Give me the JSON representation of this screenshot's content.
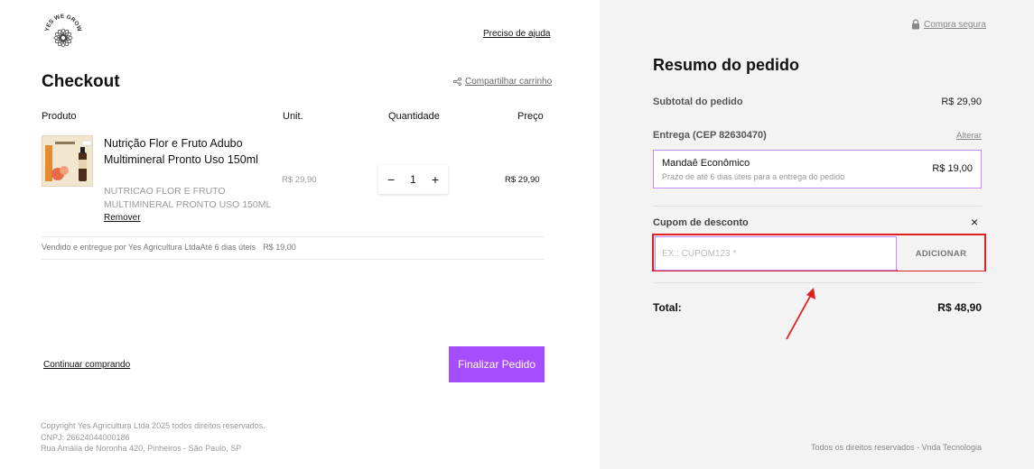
{
  "brand": {
    "logo_text": "YES WE GROW"
  },
  "header": {
    "help_link": "Preciso de ajuda",
    "title": "Checkout",
    "share_label": "Compartilhar carrinho"
  },
  "cart": {
    "columns": {
      "product": "Produto",
      "unit": "Unit.",
      "quantity": "Quantidade",
      "price": "Preço"
    },
    "items": [
      {
        "name": "Nutrição Flor e Fruto Adubo Multimineral Pronto Uso 150ml",
        "sku": "NUTRICAO FLOR E FRUTO MULTIMINERAL PRONTO USO 150ML",
        "remove_label": "Remover",
        "unit_price": "R$ 29,90",
        "quantity": "1",
        "price": "R$ 29,90"
      }
    ],
    "vendor_text": "Vendido e entregue por Yes Agricultura LtdaAté 6 dias úteis",
    "vendor_amount": "R$ 19,00"
  },
  "actions": {
    "continue_label": "Continuar comprando",
    "finalize_label": "Finalizar Pedido"
  },
  "footer_left": {
    "copyright": "Copyright Yes Agricultura Ltda 2025 todos direitos reservados.",
    "cnpj": "CNPJ: 26624044000186",
    "address": "Rua Amália de Noronha 420, Pinheiros - São Paulo, SP"
  },
  "summary": {
    "secure_label": "Compra segura",
    "title": "Resumo do pedido",
    "subtotal_label": "Subtotal do pedido",
    "subtotal_value": "R$ 29,90",
    "delivery_label": "Entrega (CEP 82630470)",
    "alter_label": "Alterar",
    "shipping": {
      "name": "Mandaê Econômico",
      "desc": "Prazo de até 6 dias úteis para a entrega do pedido",
      "price": "R$ 19,00"
    },
    "coupon_label": "Cupom de desconto",
    "coupon_close": "×",
    "coupon_placeholder": "EX.: CUPOM123 *",
    "coupon_button": "ADICIONAR",
    "total_label": "Total:",
    "total_value": "R$ 48,90"
  },
  "footer_right": "Todos os direitos reservados - Vnda Tecnologia",
  "colors": {
    "accent": "#a64dff",
    "highlight": "#e02020",
    "panel_bg": "#f3f3f3"
  }
}
